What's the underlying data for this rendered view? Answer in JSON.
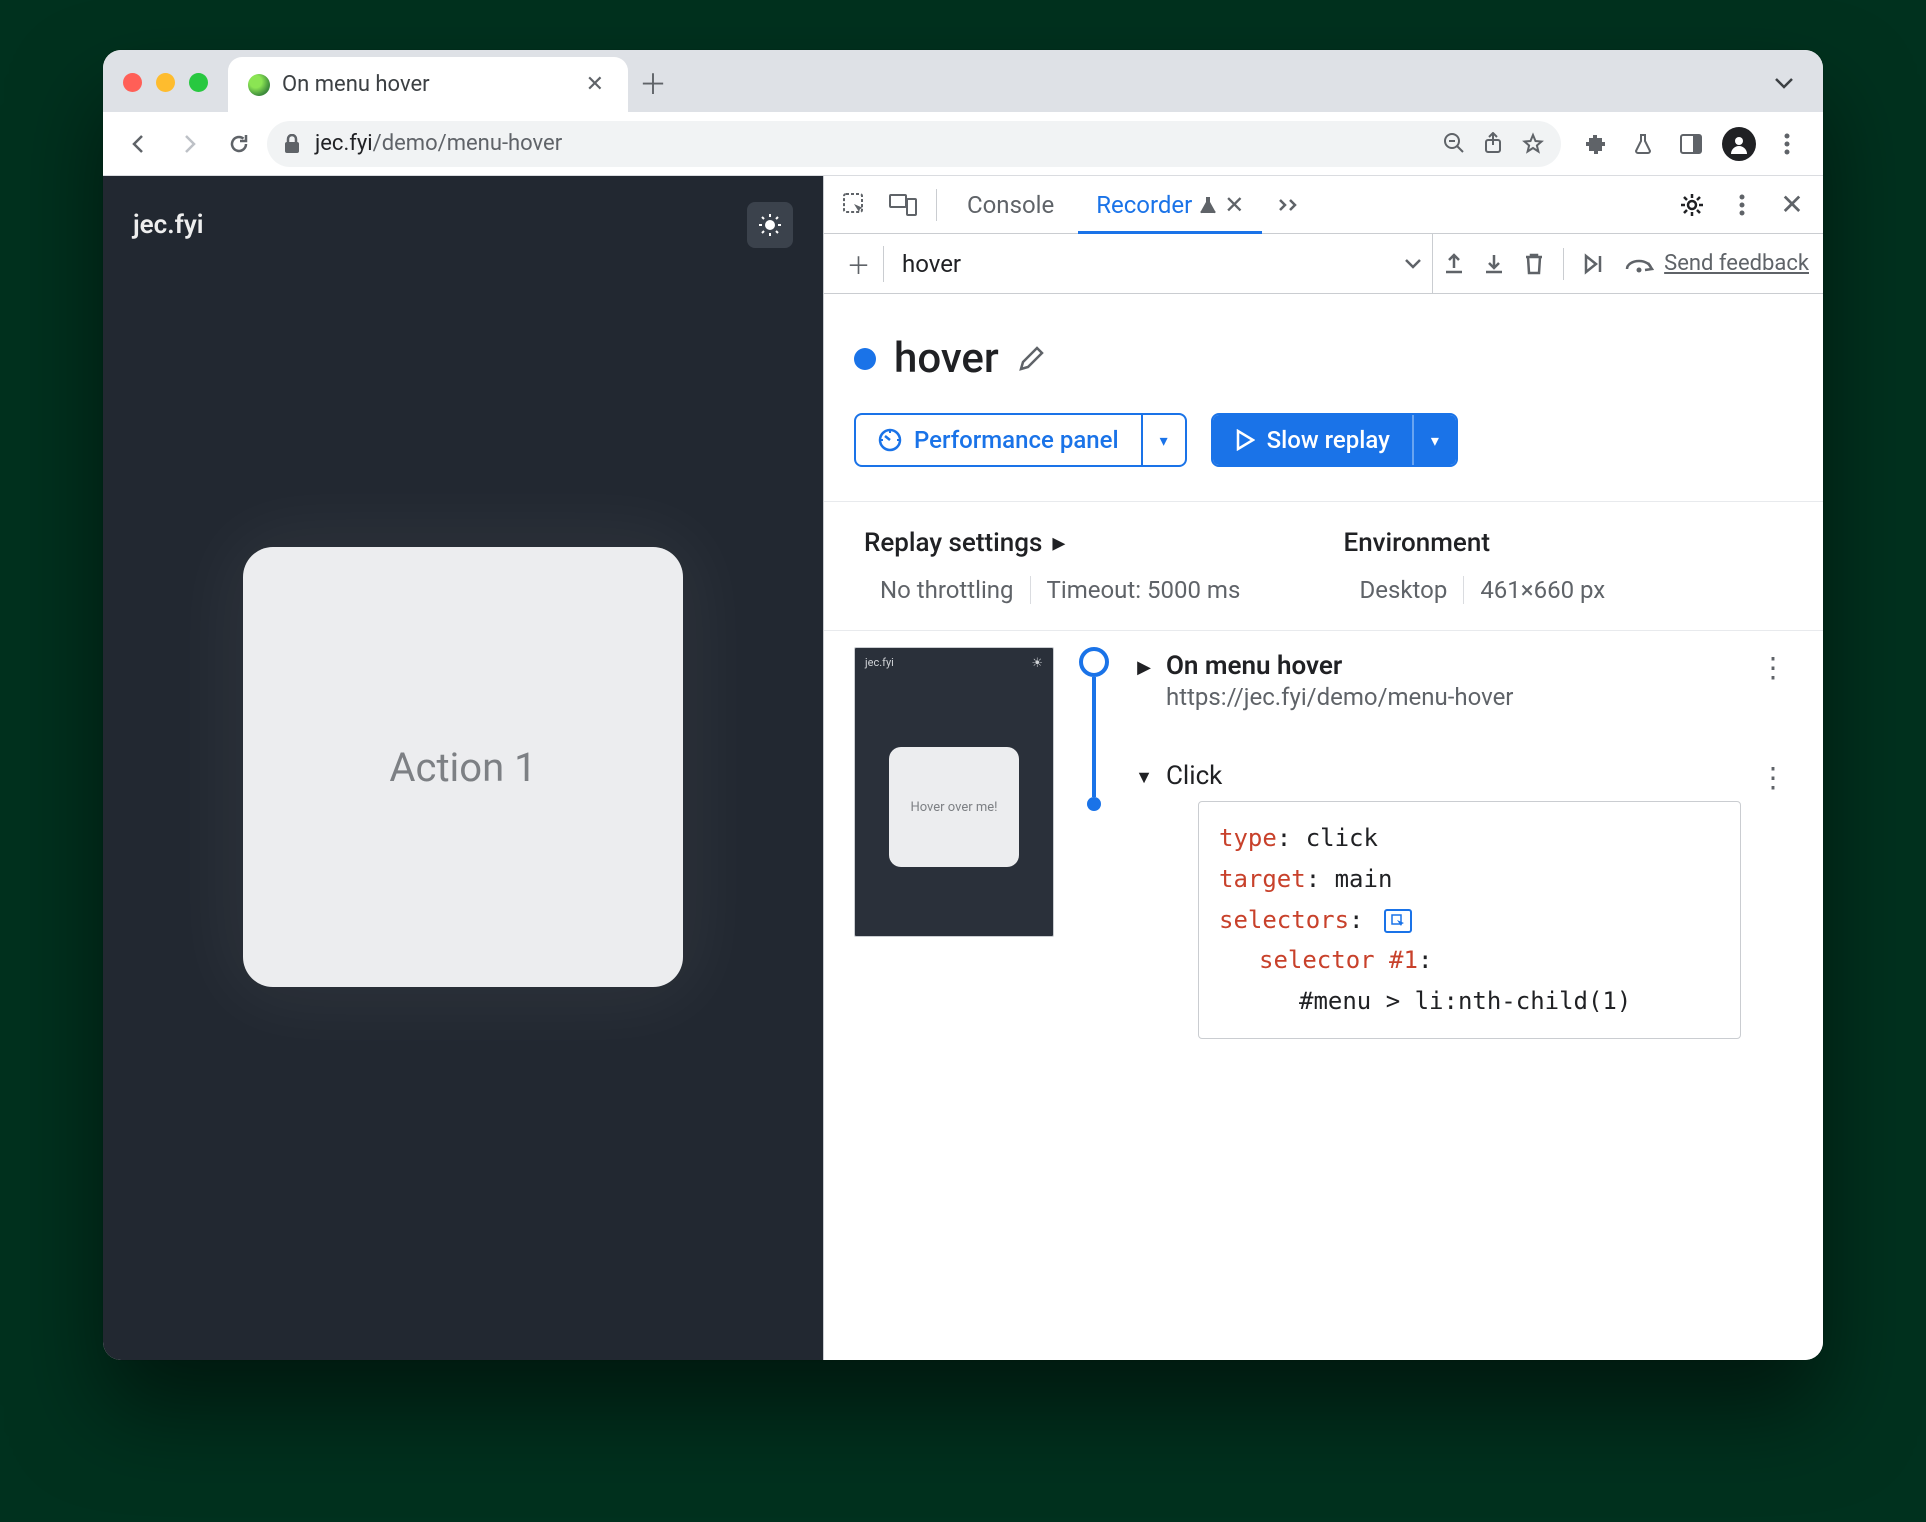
{
  "browser": {
    "tab_title": "On menu hover",
    "url_host": "jec.fyi",
    "url_path": "/demo/menu-hover"
  },
  "page": {
    "brand": "jec.fyi",
    "card_label": "Action 1"
  },
  "devtools": {
    "tabs": {
      "console": "Console",
      "recorder": "Recorder"
    },
    "recording_name": "hover",
    "send_feedback": "Send feedback",
    "title": "hover",
    "perf_button": "Performance panel",
    "replay_button": "Slow replay",
    "replay_settings_label": "Replay settings",
    "environment_label": "Environment",
    "throttling": "No throttling",
    "timeout": "Timeout: 5000 ms",
    "env_device": "Desktop",
    "env_size": "461×660 px",
    "thumb_brand": "jec.fyi",
    "thumb_card": "Hover over me!",
    "step_nav": {
      "name": "On menu hover",
      "url": "https://jec.fyi/demo/menu-hover"
    },
    "step_click": {
      "name": "Click",
      "type_key": "type",
      "type_val": "click",
      "target_key": "target",
      "target_val": "main",
      "selectors_key": "selectors",
      "selector_label": "selector #1",
      "selector_value": "#menu > li:nth-child(1)"
    }
  }
}
